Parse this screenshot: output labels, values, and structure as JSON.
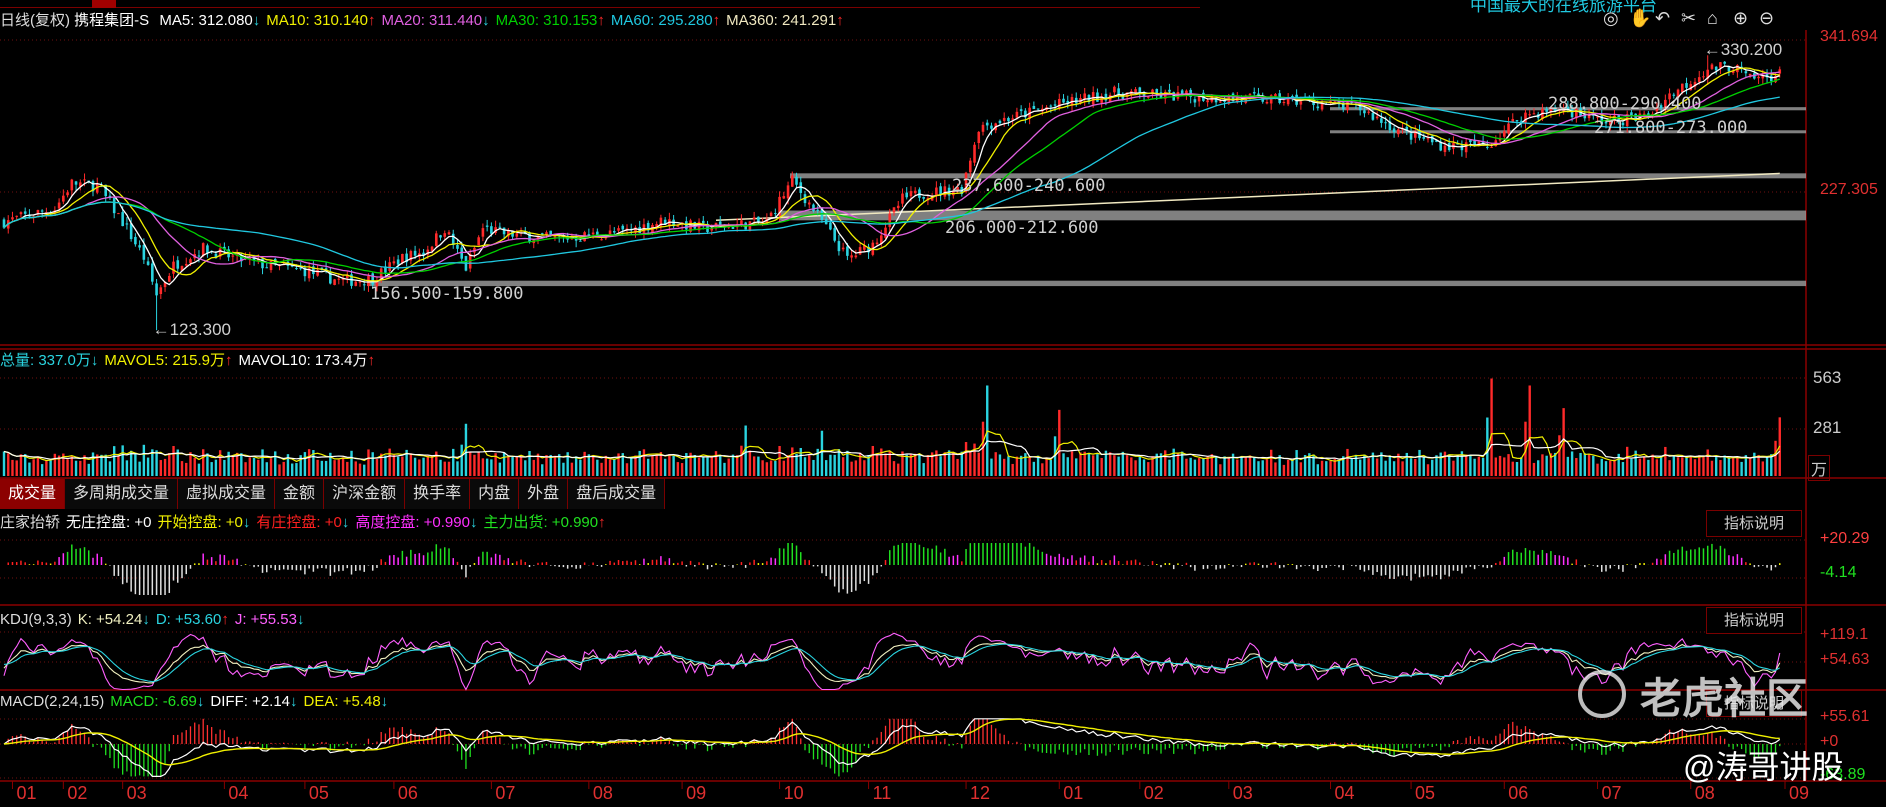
{
  "header": {
    "period": "日线(复权)",
    "stock": "携程集团-S",
    "ma": [
      {
        "label": "MA5: 312.080",
        "dir": "down",
        "color": "#ffffff"
      },
      {
        "label": "MA10: 310.140",
        "dir": "up",
        "color": "#f0f000"
      },
      {
        "label": "MA20: 311.440",
        "dir": "down",
        "color": "#e060e0"
      },
      {
        "label": "MA30: 310.153",
        "dir": "up",
        "color": "#00d000"
      },
      {
        "label": "MA60: 295.280",
        "dir": "up",
        "color": "#20c8e0"
      },
      {
        "label": "MA360: 241.291",
        "dir": "up",
        "color": "#f0e8c0"
      }
    ],
    "top_caption": "中国最大的在线旅游平台",
    "arrow_up": "↑",
    "arrow_down": "↓"
  },
  "toolbar": [
    "eye-icon",
    "hand-icon",
    "undo-icon",
    "scissors-icon",
    "clipboard-icon",
    "zoom-in-icon",
    "zoom-out-icon"
  ],
  "price_axis": {
    "top": "341.694",
    "mid": "227.305"
  },
  "annotations": {
    "high": "330.200",
    "low": "123.300",
    "zones": [
      "288.800-290.400",
      "271.800-273.000",
      "237.600-240.600",
      "206.000-212.600",
      "156.500-159.800"
    ]
  },
  "volume": {
    "header": [
      {
        "label": "总量: 337.0万",
        "dir": "down",
        "color": "#2ad4e0"
      },
      {
        "label": "MAVOL5: 215.9万",
        "dir": "up",
        "color": "#f0f000"
      },
      {
        "label": "MAVOL10: 173.4万",
        "dir": "up",
        "color": "#ffffff"
      }
    ],
    "axis": [
      "563",
      "281"
    ],
    "unit": "万"
  },
  "tabs": [
    "成交量",
    "多周期成交量",
    "虚拟成交量",
    "金额",
    "沪深金额",
    "换手率",
    "内盘",
    "外盘",
    "盘后成交量"
  ],
  "indicator1": {
    "name": "庄家抬轿",
    "items": [
      {
        "label": "无庄控盘: +0",
        "dir": "",
        "color": "#ffffff"
      },
      {
        "label": "开始控盘: +0",
        "dir": "down",
        "color": "#f0f000"
      },
      {
        "label": "有庄控盘: +0",
        "dir": "down",
        "color": "#ff2020"
      },
      {
        "label": "高度控盘: +0.990",
        "dir": "down",
        "color": "#ff30ff"
      },
      {
        "label": "主力出货: +0.990",
        "dir": "up",
        "color": "#20e020"
      }
    ],
    "axis": [
      "+20.29",
      "-4.14"
    ],
    "help": "指标说明"
  },
  "kdj": {
    "name": "KDJ(9,3,3)",
    "items": [
      {
        "label": "K: +54.24",
        "dir": "down",
        "color": "#f0f0c0"
      },
      {
        "label": "D: +53.60",
        "dir": "up",
        "color": "#2ad4e0"
      },
      {
        "label": "J: +55.53",
        "dir": "down",
        "color": "#ff60ff"
      }
    ],
    "axis": [
      "+119.1",
      "+54.63"
    ],
    "help": "指标说明"
  },
  "macd": {
    "name": "MACD(2,24,15)",
    "items": [
      {
        "label": "MACD: -6.69",
        "dir": "down",
        "color": "#20e020"
      },
      {
        "label": "DIFF: +2.14",
        "dir": "down",
        "color": "#ffffff"
      },
      {
        "label": "DEA: +5.48",
        "dir": "down",
        "color": "#f0f000"
      }
    ],
    "axis": [
      "+55.61",
      "+0",
      "-63.89"
    ],
    "help": "指标说明"
  },
  "watermark": {
    "brand": "老虎社区",
    "author": "@涛哥讲股"
  },
  "colors": {
    "up": "#ff2a2a",
    "down": "#2ad4e0",
    "grid": "#8a0000",
    "zone": "#a0a0a0"
  },
  "chart_data": {
    "type": "candlestick",
    "title": "携程集团-S 日线(复权)",
    "bars": 420,
    "ylim": [
      115,
      345
    ],
    "x_ticks": [
      {
        "label": "01",
        "i": 2
      },
      {
        "label": "02",
        "i": 14
      },
      {
        "label": "03",
        "i": 28
      },
      {
        "label": "04",
        "i": 52
      },
      {
        "label": "05",
        "i": 71
      },
      {
        "label": "06",
        "i": 92
      },
      {
        "label": "07",
        "i": 115
      },
      {
        "label": "08",
        "i": 138
      },
      {
        "label": "09",
        "i": 160
      },
      {
        "label": "10",
        "i": 183
      },
      {
        "label": "11",
        "i": 204
      },
      {
        "label": "12",
        "i": 227
      },
      {
        "label": "01",
        "i": 249
      },
      {
        "label": "02",
        "i": 268
      },
      {
        "label": "03",
        "i": 289
      },
      {
        "label": "04",
        "i": 313
      },
      {
        "label": "05",
        "i": 332
      },
      {
        "label": "06",
        "i": 354
      },
      {
        "label": "07",
        "i": 376
      },
      {
        "label": "08",
        "i": 398
      },
      {
        "label": "09",
        "i": 421
      }
    ],
    "close_path": [
      [
        0,
        205
      ],
      [
        12,
        215
      ],
      [
        16,
        234
      ],
      [
        22,
        232
      ],
      [
        28,
        205
      ],
      [
        33,
        178
      ],
      [
        36,
        150
      ],
      [
        40,
        172
      ],
      [
        47,
        185
      ],
      [
        54,
        178
      ],
      [
        62,
        172
      ],
      [
        71,
        168
      ],
      [
        80,
        160
      ],
      [
        87,
        162
      ],
      [
        94,
        178
      ],
      [
        99,
        182
      ],
      [
        104,
        200
      ],
      [
        109,
        170
      ],
      [
        113,
        200
      ],
      [
        118,
        196
      ],
      [
        130,
        192
      ],
      [
        146,
        197
      ],
      [
        156,
        206
      ],
      [
        165,
        200
      ],
      [
        180,
        205
      ],
      [
        186,
        236
      ],
      [
        192,
        210
      ],
      [
        199,
        177
      ],
      [
        205,
        188
      ],
      [
        212,
        222
      ],
      [
        216,
        226
      ],
      [
        226,
        230
      ],
      [
        230,
        276
      ],
      [
        236,
        282
      ],
      [
        250,
        294
      ],
      [
        262,
        302
      ],
      [
        272,
        300
      ],
      [
        290,
        298
      ],
      [
        305,
        296
      ],
      [
        320,
        290
      ],
      [
        330,
        272
      ],
      [
        340,
        262
      ],
      [
        350,
        262
      ],
      [
        358,
        285
      ],
      [
        368,
        290
      ],
      [
        378,
        280
      ],
      [
        388,
        285
      ],
      [
        393,
        300
      ],
      [
        402,
        320
      ],
      [
        408,
        322
      ],
      [
        412,
        312
      ],
      [
        419,
        316
      ]
    ],
    "low_point": [
      36,
      123.3
    ],
    "high_point": [
      402,
      330.2
    ],
    "zones": [
      [
        288.8,
        290.4
      ],
      [
        271.8,
        273.0
      ],
      [
        237.6,
        240.6
      ],
      [
        206.0,
        212.6
      ],
      [
        156.5,
        159.8
      ]
    ],
    "ma360": [
      [
        168,
        206
      ],
      [
        419,
        241.291
      ]
    ],
    "volume_spikes": [
      [
        109,
        300
      ],
      [
        175,
        290
      ],
      [
        193,
        260
      ],
      [
        232,
        520
      ],
      [
        249,
        380
      ],
      [
        351,
        560
      ],
      [
        360,
        520
      ],
      [
        368,
        390
      ],
      [
        419,
        337
      ]
    ]
  }
}
